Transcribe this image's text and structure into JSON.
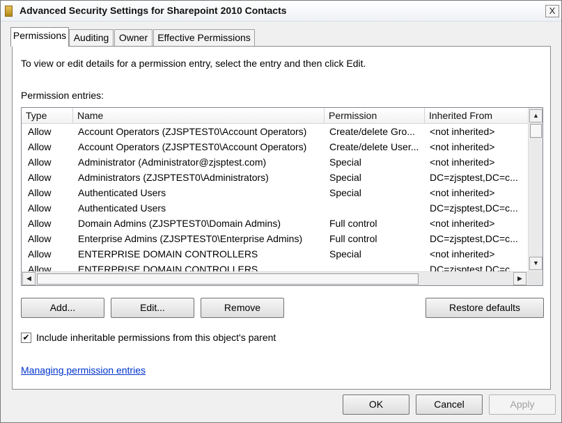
{
  "window": {
    "title": "Advanced Security Settings for Sharepoint 2010 Contacts",
    "close_label": "X"
  },
  "tabs": [
    {
      "label": "Permissions",
      "active": true
    },
    {
      "label": "Auditing",
      "active": false
    },
    {
      "label": "Owner",
      "active": false
    },
    {
      "label": "Effective Permissions",
      "active": false
    }
  ],
  "instruction": "To view or edit details for a permission entry, select the entry and then click Edit.",
  "entries_label": "Permission entries:",
  "table": {
    "columns": [
      "Type",
      "Name",
      "Permission",
      "Inherited From"
    ],
    "rows": [
      [
        "Allow",
        "Account Operators (ZJSPTEST0\\Account Operators)",
        "Create/delete Gro...",
        "<not inherited>"
      ],
      [
        "Allow",
        "Account Operators (ZJSPTEST0\\Account Operators)",
        "Create/delete User...",
        "<not inherited>"
      ],
      [
        "Allow",
        "Administrator (Administrator@zjsptest.com)",
        "Special",
        "<not inherited>"
      ],
      [
        "Allow",
        "Administrators (ZJSPTEST0\\Administrators)",
        "Special",
        "DC=zjsptest,DC=c..."
      ],
      [
        "Allow",
        "Authenticated Users",
        "Special",
        "<not inherited>"
      ],
      [
        "Allow",
        "Authenticated Users",
        "",
        "DC=zjsptest,DC=c..."
      ],
      [
        "Allow",
        "Domain Admins (ZJSPTEST0\\Domain Admins)",
        "Full control",
        "<not inherited>"
      ],
      [
        "Allow",
        "Enterprise Admins (ZJSPTEST0\\Enterprise Admins)",
        "Full control",
        "DC=zjsptest,DC=c..."
      ],
      [
        "Allow",
        "ENTERPRISE DOMAIN CONTROLLERS",
        "Special",
        "<not inherited>"
      ],
      [
        "Allow",
        "ENTERPRISE DOMAIN CONTROLLERS",
        "",
        "DC=zjsptest,DC=c..."
      ]
    ]
  },
  "buttons": {
    "add": "Add...",
    "edit": "Edit...",
    "remove": "Remove",
    "restore": "Restore defaults",
    "ok": "OK",
    "cancel": "Cancel",
    "apply": "Apply"
  },
  "checkbox": {
    "label": "Include inheritable permissions from this object's parent",
    "checked": true,
    "mark": "✔"
  },
  "link": "Managing permission entries",
  "icons": {
    "title": "folder-icon",
    "scroll_up": "▲",
    "scroll_down": "▼",
    "scroll_left": "◀",
    "scroll_right": "▶"
  }
}
